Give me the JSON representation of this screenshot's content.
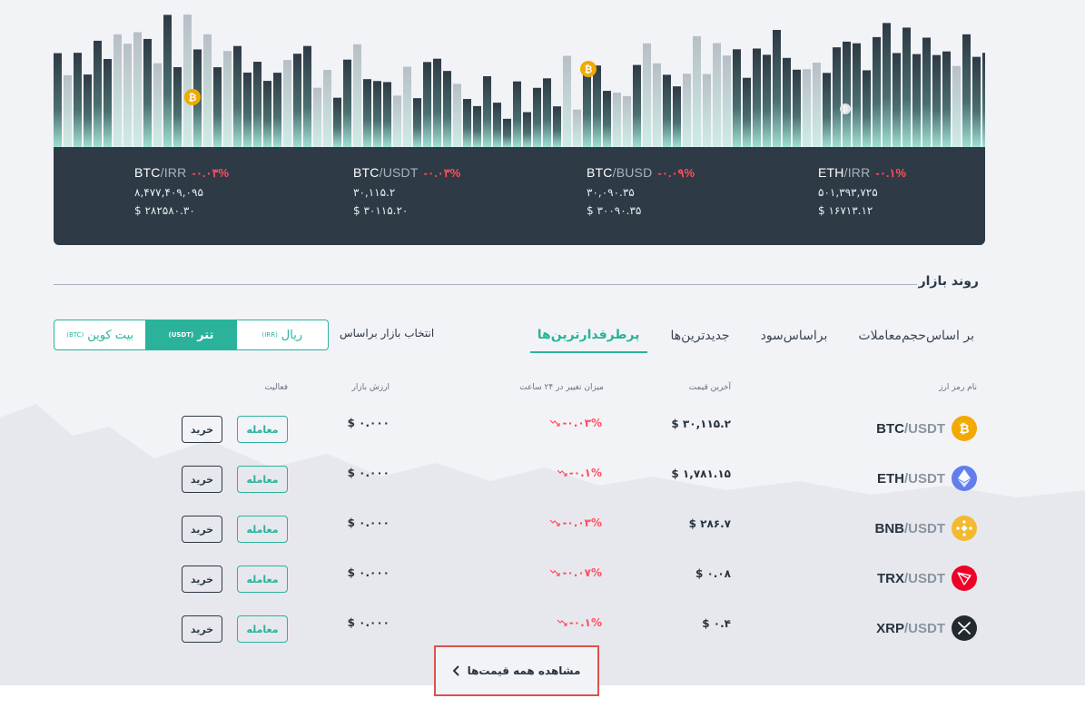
{
  "ticker": [
    {
      "base": "BTC",
      "quote": "IRR",
      "change": "-۰.۰۳%",
      "irr": "۸,۴۷۷,۴۰۹,۰۹۵",
      "usd": "$ ۲۸۲۵۸۰.۳۰"
    },
    {
      "base": "BTC",
      "quote": "USDT",
      "change": "-۰.۰۳%",
      "irr": "۳۰,۱۱۵.۲",
      "usd": "$ ۳۰۱۱۵.۲۰"
    },
    {
      "base": "BTC",
      "quote": "BUSD",
      "change": "-۰.۰۹%",
      "irr": "۳۰,۰۹۰.۳۵",
      "usd": "$ ۳۰۰۹۰.۳۵"
    },
    {
      "base": "ETH",
      "quote": "IRR",
      "change": "-۰.۱%",
      "irr": "۵۰۱,۳۹۳,۷۲۵",
      "usd": "$ ۱۶۷۱۳.۱۲"
    }
  ],
  "section": {
    "title": "روند بازار"
  },
  "tabs": [
    "پرطرفدارترین‌ها",
    "جدیدترین‌ها",
    "براساس‌سود",
    "بر اساس‌حجم‌معاملات"
  ],
  "market_select": {
    "label": "انتخاب بازار براساس",
    "options": [
      {
        "label": "ریال",
        "code": "(IRR)"
      },
      {
        "label": "تتر",
        "code": "(USDT)"
      },
      {
        "label": "بیت کوین",
        "code": "(BTC)"
      }
    ]
  },
  "table": {
    "headers": {
      "name": "نام رمز ارز",
      "price": "آخرین قیمت",
      "change": "میزان تغییر در ۲۴ ساعت",
      "mcap": "ارزش بازار",
      "action": "فعالیت"
    },
    "rows": [
      {
        "base": "BTC",
        "quote": "/USDT",
        "price": "$ ۳۰,۱۱۵.۲",
        "change": "-۰.۰۳%",
        "mcap": "$ ۰.۰۰۰",
        "icon": "bitcoin-icon",
        "color": "#f2a900"
      },
      {
        "base": "ETH",
        "quote": "/USDT",
        "price": "$ ۱,۷۸۱.۱۵",
        "change": "-۰.۱%",
        "mcap": "$ ۰.۰۰۰",
        "icon": "ethereum-icon",
        "color": "#627eea"
      },
      {
        "base": "BNB",
        "quote": "/USDT",
        "price": "$ ۲۸۶.۷",
        "change": "-۰.۰۳%",
        "mcap": "$ ۰.۰۰۰",
        "icon": "bnb-icon",
        "color": "#f3ba2f"
      },
      {
        "base": "TRX",
        "quote": "/USDT",
        "price": "$ ۰.۰۸",
        "change": "-۰.۰۷%",
        "mcap": "$ ۰.۰۰۰",
        "icon": "tron-icon",
        "color": "#ef0027"
      },
      {
        "base": "XRP",
        "quote": "/USDT",
        "price": "$ ۰.۴",
        "change": "-۰.۱%",
        "mcap": "$ ۰.۰۰۰",
        "icon": "xrp-icon",
        "color": "#23292f"
      }
    ],
    "trade_label": "معامله",
    "buy_label": "خرید"
  },
  "view_all": {
    "label": "مشاهده همه قیمت‌ها"
  },
  "colors": {
    "accent": "#2ab39a",
    "negative": "#ff4d5e",
    "dark": "#2e3a45"
  }
}
